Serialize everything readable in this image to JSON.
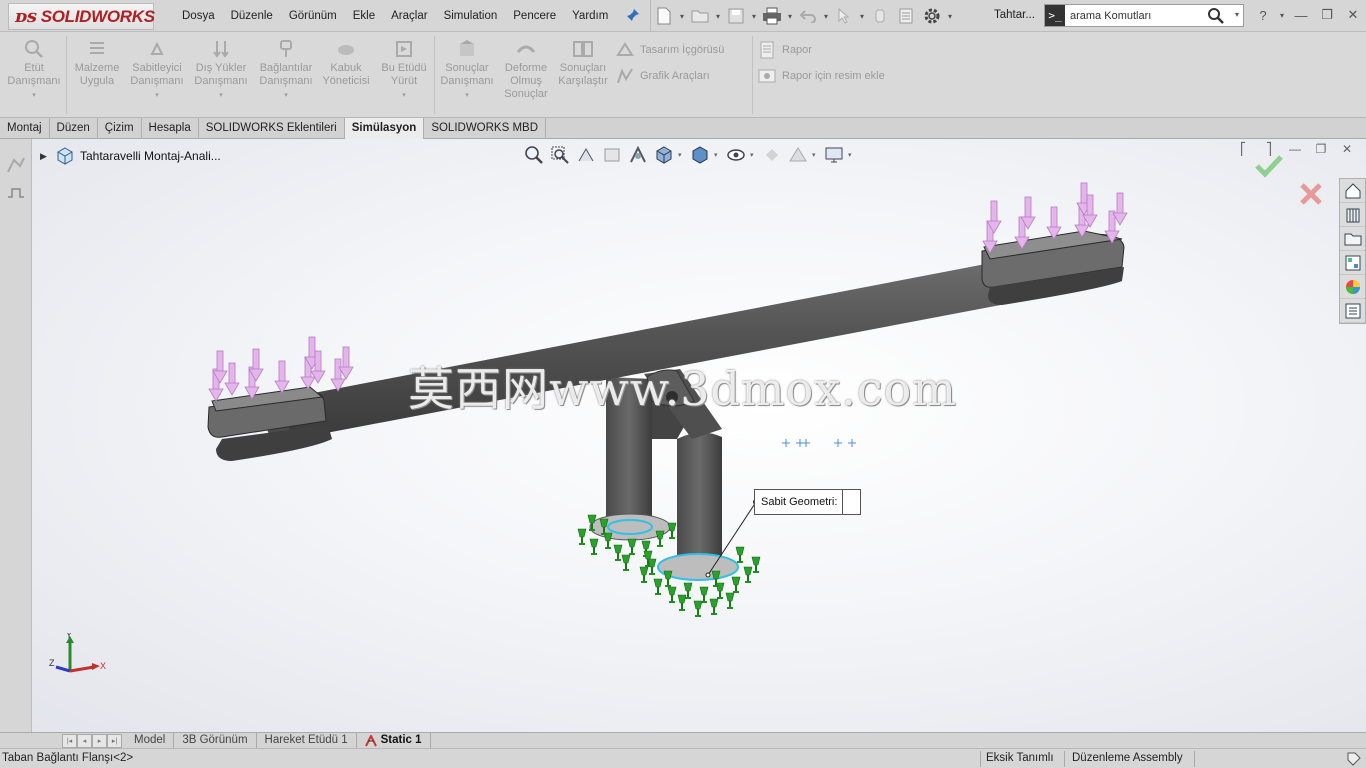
{
  "app": {
    "logo_text": "SOLIDWORKS",
    "doc_title": "Tahtar...",
    "search_placeholder": "arama Komutları"
  },
  "menu": [
    "Dosya",
    "Düzenle",
    "Görünüm",
    "Ekle",
    "Araçlar",
    "Simulation",
    "Pencere",
    "Yardım"
  ],
  "ribbon": {
    "etut": "Etüt Danışmanı",
    "malzeme": "Malzeme Uygula",
    "sabitleyici": "Sabitleyici Danışmanı",
    "disyukler": "Dış Yükler Danışmanı",
    "baglantilar": "Bağlantılar Danışmanı",
    "kabuk": "Kabuk Yöneticisi",
    "yurut": "Bu Etüdü Yürüt",
    "sonuclar": "Sonuçlar Danışmanı",
    "deforme": "Deforme Olmuş Sonuçlar",
    "karsilastir": "Sonuçları Karşılaştır",
    "tasarim": "Tasarım İçgörüsü",
    "grafik": "Grafik Araçları",
    "rapor": "Rapor",
    "rapor_resim": "Rapor için resim ekle"
  },
  "tabs": [
    "Montaj",
    "Düzen",
    "Çizim",
    "Hesapla",
    "SOLIDWORKS Eklentileri",
    "Simülasyon",
    "SOLIDWORKS MBD"
  ],
  "active_tab": "Simülasyon",
  "tree": {
    "item": "Tahtaravelli Montaj-Anali..."
  },
  "callout": {
    "text": "Sabit Geometri:"
  },
  "watermark": "莫西网www.3dmox.com",
  "triad": {
    "y": "Y",
    "z": "Z",
    "x": "X"
  },
  "bottom_tabs": [
    "Model",
    "3B Görünüm",
    "Hareket Etüdü 1",
    "Static 1"
  ],
  "active_bottom_tab": "Static 1",
  "status": {
    "left": "Taban Bağlantı Flanşı<2>",
    "definition": "Eksik Tanımlı",
    "mode": "Düzenleme Assembly"
  },
  "colors": {
    "brand_red": "#b01f24",
    "load_arrows": "#d9a0e0",
    "fixture_green": "#1f8f1f",
    "part_gray": "#5a5a5a"
  }
}
